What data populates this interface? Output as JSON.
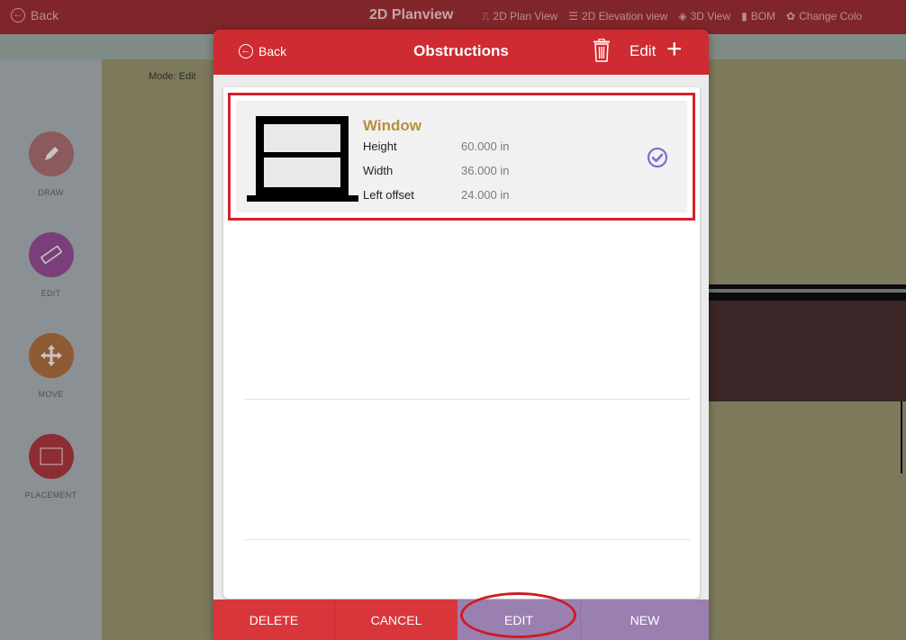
{
  "topbar": {
    "back_label": "Back",
    "title": "2D Planview",
    "nav": [
      {
        "icon": "plan-view-icon",
        "glyph": "⎍",
        "label": "2D Plan View"
      },
      {
        "icon": "elevation-list-icon",
        "glyph": "☰",
        "label": "2D Elevation view"
      },
      {
        "icon": "cube-3d-icon",
        "glyph": "◈",
        "label": "3D View"
      },
      {
        "icon": "document-icon",
        "glyph": "▮",
        "label": "BOM"
      },
      {
        "icon": "palette-icon",
        "glyph": "✿",
        "label": "Change Colo"
      }
    ]
  },
  "canvas": {
    "mode_label": "Mode: Edit"
  },
  "tools": [
    {
      "name": "draw",
      "label": "DRAW",
      "icon": "pencil-icon",
      "color": "#8a5a5c"
    },
    {
      "name": "edit",
      "label": "EDIT",
      "icon": "ruler-icon",
      "color": "#7a3f7b"
    },
    {
      "name": "move",
      "label": "MOVE",
      "icon": "move-arrows-icon",
      "color": "#8f5b34"
    },
    {
      "name": "placement",
      "label": "PLACEMENT",
      "icon": "placement-frame-icon",
      "color": "#8b2d33"
    }
  ],
  "modal": {
    "back_label": "Back",
    "title": "Obstructions",
    "edit_label": "Edit",
    "add_label": "+",
    "items": [
      {
        "name": "Window",
        "icon": "window-icon",
        "selected": true,
        "props": [
          {
            "label": "Height",
            "value": "60.000 in"
          },
          {
            "label": "Width",
            "value": "36.000 in"
          },
          {
            "label": "Left offset",
            "value": "24.000 in"
          }
        ]
      }
    ],
    "actions": {
      "delete": "DELETE",
      "cancel": "CANCEL",
      "edit": "EDIT",
      "new": "NEW"
    }
  },
  "colors": {
    "header_red": "#cf2b33",
    "item_name": "#b68f3e",
    "selected_check": "#7b6fd1",
    "purple_action": "#9a7fb1",
    "highlight": "#d71f28"
  }
}
